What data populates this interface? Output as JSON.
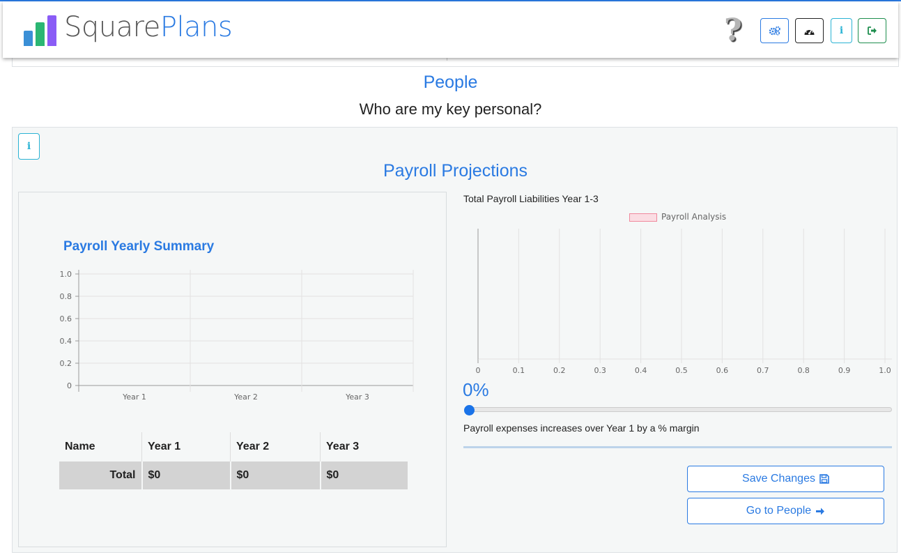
{
  "header": {
    "brand_part1": "Square",
    "brand_part2": "Plans",
    "help_glyph": "?",
    "buttons": [
      {
        "name": "settings-button",
        "icon": "gears-icon",
        "color": "#2a7ae2"
      },
      {
        "name": "dashboard-button",
        "icon": "dashboard-icon",
        "color": "#222222"
      },
      {
        "name": "info-button",
        "icon": "info-icon",
        "color": "#2ab3d4"
      },
      {
        "name": "logout-button",
        "icon": "sign-out-icon",
        "color": "#1e8e4e"
      }
    ],
    "logo_colors": [
      "#3a8fd6",
      "#2bb673",
      "#8a5cf6"
    ]
  },
  "page": {
    "title": "People",
    "subtitle": "Who are my key personal?"
  },
  "section": {
    "title": "Payroll Projections",
    "info_glyph": "i"
  },
  "summary": {
    "title": "Payroll Yearly Summary",
    "table": {
      "headers": [
        "Name",
        "Year 1",
        "Year 2",
        "Year 3"
      ],
      "rows": [
        {
          "label": "Total",
          "values": [
            "$0",
            "$0",
            "$0"
          ]
        }
      ]
    }
  },
  "liabilities": {
    "title": "Total Payroll Liabilities Year 1-3",
    "legend": "Payroll Analysis",
    "percent_text": "0%",
    "percent_value": 0,
    "caption": "Payroll expenses increases over Year 1 by a % margin"
  },
  "actions": {
    "save_label": "Save Changes",
    "go_label": "Go to People"
  },
  "chart_data": [
    {
      "type": "bar",
      "title": "Payroll Yearly Summary",
      "categories": [
        "Year 1",
        "Year 2",
        "Year 3"
      ],
      "values": [
        0,
        0,
        0
      ],
      "yticks": [
        "0",
        "0.2",
        "0.4",
        "0.6",
        "0.8",
        "1.0"
      ],
      "ylim": [
        0,
        1.0
      ],
      "grid": true
    },
    {
      "type": "bar",
      "title": "Total Payroll Liabilities Year 1-3",
      "orientation": "horizontal",
      "series": [
        {
          "name": "Payroll Analysis",
          "values": []
        }
      ],
      "xticks": [
        "0",
        "0.1",
        "0.2",
        "0.3",
        "0.4",
        "0.5",
        "0.6",
        "0.7",
        "0.8",
        "0.9",
        "1.0"
      ],
      "xlim": [
        0,
        1.0
      ],
      "legend": "top",
      "grid": true
    }
  ]
}
